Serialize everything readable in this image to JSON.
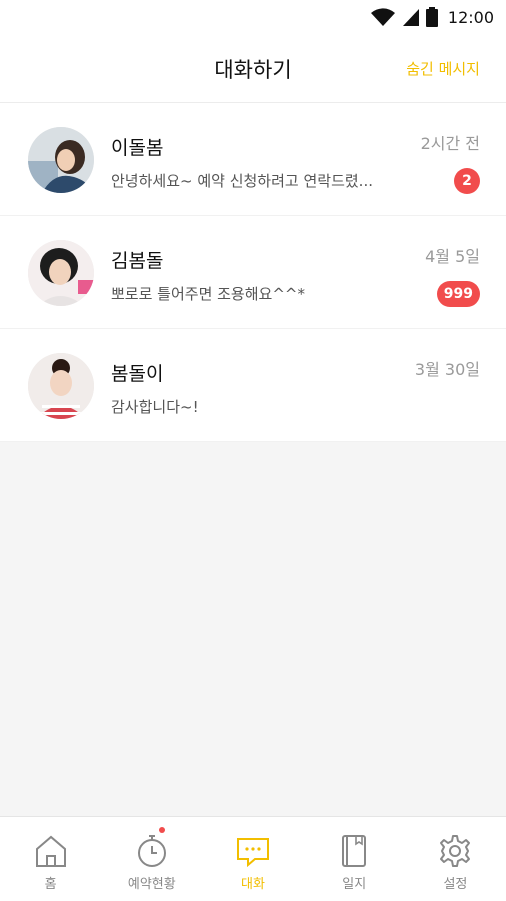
{
  "status_bar": {
    "time": "12:00"
  },
  "header": {
    "title": "대화하기",
    "hidden_messages": "숨긴 메시지"
  },
  "conversations": [
    {
      "name": "이돌봄",
      "preview": "안녕하세요~ 예약 신청하려고 연락드렸...",
      "time": "2시간 전",
      "badge": "2"
    },
    {
      "name": "김봄돌",
      "preview": "뽀로로 틀어주면 조용해요^^*",
      "time": "4월 5일",
      "badge": "999"
    },
    {
      "name": "봄돌이",
      "preview": "감사합니다~!",
      "time": "3월 30일",
      "badge": ""
    }
  ],
  "tabs": [
    {
      "label": "홈",
      "icon": "home-icon",
      "active": false
    },
    {
      "label": "예약현황",
      "icon": "stopwatch-icon",
      "active": false,
      "notification": true
    },
    {
      "label": "대화",
      "icon": "chat-icon",
      "active": true
    },
    {
      "label": "일지",
      "icon": "journal-icon",
      "active": false
    },
    {
      "label": "설정",
      "icon": "gear-icon",
      "active": false
    }
  ],
  "colors": {
    "accent": "#f2be00",
    "badge": "#f14c4c",
    "background": "#f5f5f5"
  }
}
